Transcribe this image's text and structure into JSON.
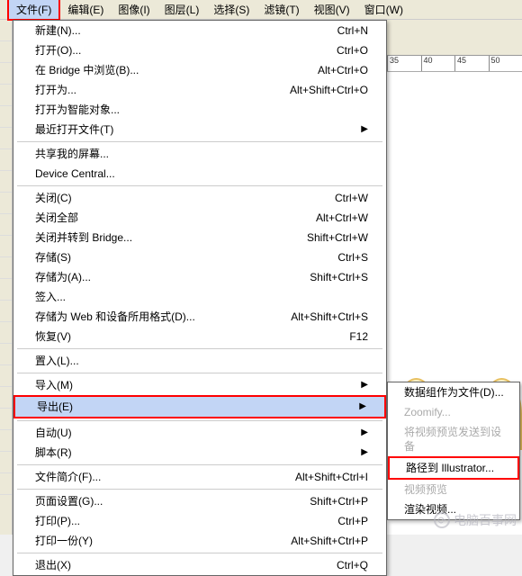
{
  "menubar": {
    "file": "文件(F)",
    "edit": "编辑(E)",
    "image": "图像(I)",
    "layer": "图层(L)",
    "select": "选择(S)",
    "filter": "滤镜(T)",
    "view": "视图(V)",
    "window": "窗口(W)"
  },
  "ruler": [
    "35",
    "40",
    "45",
    "50"
  ],
  "file_menu": {
    "new": {
      "label": "新建(N)...",
      "shortcut": "Ctrl+N"
    },
    "open": {
      "label": "打开(O)...",
      "shortcut": "Ctrl+O"
    },
    "browse_bridge": {
      "label": "在 Bridge 中浏览(B)...",
      "shortcut": "Alt+Ctrl+O"
    },
    "open_as": {
      "label": "打开为...",
      "shortcut": "Alt+Shift+Ctrl+O"
    },
    "open_smart": {
      "label": "打开为智能对象..."
    },
    "recent": {
      "label": "最近打开文件(T)"
    },
    "share_screen": {
      "label": "共享我的屏幕..."
    },
    "device_central": {
      "label": "Device Central..."
    },
    "close": {
      "label": "关闭(C)",
      "shortcut": "Ctrl+W"
    },
    "close_all": {
      "label": "关闭全部",
      "shortcut": "Alt+Ctrl+W"
    },
    "close_bridge": {
      "label": "关闭并转到 Bridge...",
      "shortcut": "Shift+Ctrl+W"
    },
    "save": {
      "label": "存储(S)",
      "shortcut": "Ctrl+S"
    },
    "save_as": {
      "label": "存储为(A)...",
      "shortcut": "Shift+Ctrl+S"
    },
    "checkin": {
      "label": "签入..."
    },
    "save_web": {
      "label": "存储为 Web 和设备所用格式(D)...",
      "shortcut": "Alt+Shift+Ctrl+S"
    },
    "revert": {
      "label": "恢复(V)",
      "shortcut": "F12"
    },
    "place": {
      "label": "置入(L)..."
    },
    "import": {
      "label": "导入(M)"
    },
    "export": {
      "label": "导出(E)"
    },
    "automate": {
      "label": "自动(U)"
    },
    "scripts": {
      "label": "脚本(R)"
    },
    "file_info": {
      "label": "文件简介(F)...",
      "shortcut": "Alt+Shift+Ctrl+I"
    },
    "page_setup": {
      "label": "页面设置(G)...",
      "shortcut": "Shift+Ctrl+P"
    },
    "print": {
      "label": "打印(P)...",
      "shortcut": "Ctrl+P"
    },
    "print_one": {
      "label": "打印一份(Y)",
      "shortcut": "Alt+Shift+Ctrl+P"
    },
    "exit": {
      "label": "退出(X)",
      "shortcut": "Ctrl+Q"
    }
  },
  "export_submenu": {
    "datasets": "数据组作为文件(D)...",
    "zoomify": "Zoomify...",
    "send_video": "将视频预览发送到设备",
    "paths_ai": "路径到 Illustrator...",
    "video_preview": "视频预览",
    "render_video": "渲染视频..."
  },
  "watermark": "电脑百事网"
}
